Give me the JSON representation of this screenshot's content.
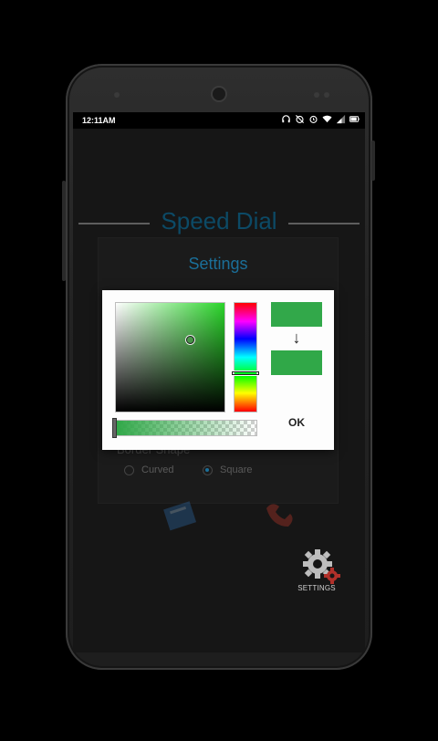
{
  "status_bar": {
    "time": "12:11AM",
    "icons": [
      "headset-icon",
      "alarm-off-icon",
      "alarm-icon",
      "wifi-icon",
      "signal-icon",
      "battery-icon"
    ]
  },
  "app": {
    "title": "Speed Dial"
  },
  "settings": {
    "title": "Settings",
    "border_shape_label": "Border Shape",
    "options": [
      {
        "label": "Curved",
        "checked": false
      },
      {
        "label": "Square",
        "checked": true
      }
    ],
    "accent_color": "#1b6f99"
  },
  "color_picker": {
    "hue_color": "#2ad52a",
    "old_color": "#32a84a",
    "new_color": "#30a848",
    "arrow": "↓",
    "ok_label": "OK"
  },
  "bottom": {
    "settings_label": "SETTINGS"
  }
}
